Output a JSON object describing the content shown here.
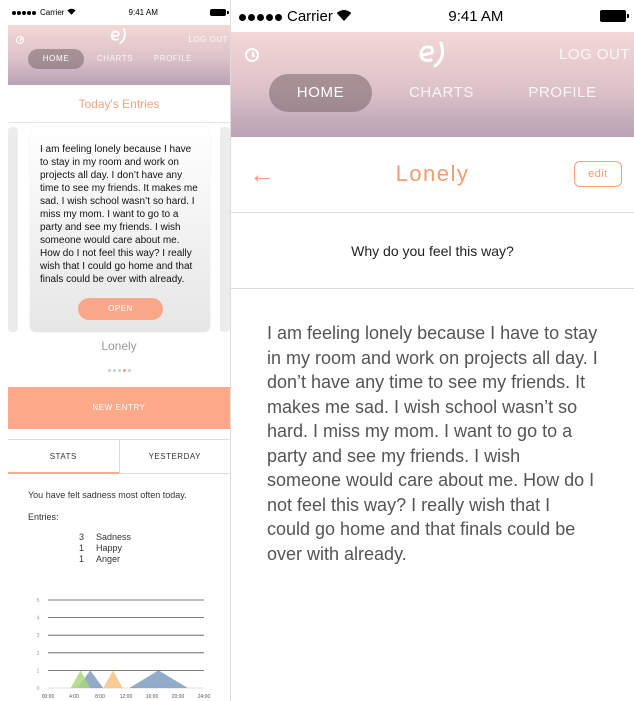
{
  "status": {
    "carrier": "Carrier",
    "time": "9:41 AM"
  },
  "header": {
    "logout_label": "LOG OUT",
    "tabs": [
      {
        "label": "HOME",
        "active": true
      },
      {
        "label": "CHARTS",
        "active": false
      },
      {
        "label": "PROFILE",
        "active": false
      }
    ]
  },
  "home": {
    "section_title": "Today's Entries",
    "card": {
      "text": "I am feeling lonely because I have to stay in my room and work on projects all day. I don’t have any time to see my friends. It makes me sad. I wish school wasn’t so hard. I miss my mom. I want to go to a party and see my friends. I wish someone would care about me. How do I not feel this way? I really wish that I could go home and that finals could be over with already.",
      "open_label": "OPEN",
      "caption": "Lonely"
    },
    "pager_count": 5,
    "pager_active": 4,
    "new_entry_label": "NEW ENTRY",
    "segments": [
      "STATS",
      "YESTERDAY"
    ],
    "stats_message": "You have felt sadness most often today.",
    "entries_label": "Entries:",
    "entries": [
      {
        "count": "3",
        "emotion": "Sadness"
      },
      {
        "count": "1",
        "emotion": "Happy"
      },
      {
        "count": "1",
        "emotion": "Anger"
      }
    ]
  },
  "detail": {
    "title": "Lonely",
    "edit_label": "edit",
    "question": "Why do you feel this way?",
    "body": "I am feeling lonely because I have to stay in my room and work on projects all day. I don’t have any time to see my friends. It makes me sad. I wish school wasn’t so hard. I miss my mom. I want to go to a party and see my friends. I wish someone would care about me. How do I not feel this way? I really wish that I could go home and that finals could be over with already."
  },
  "colors": {
    "accent": "#fea98a",
    "accent_text": "#f49b6f",
    "sadness": "#7f9cc0",
    "happy": "#a9d780",
    "anger": "#f6c283"
  },
  "chart_data": {
    "type": "area",
    "x_ticks": [
      "00:00",
      "4:00",
      "8:00",
      "12:00",
      "16:00",
      "20:00",
      "24:00"
    ],
    "y_ticks": [
      "0",
      "1",
      "2",
      "3",
      "4",
      "5"
    ],
    "ylim": [
      0,
      5
    ],
    "xlim": [
      0,
      24
    ],
    "grid": true,
    "series": [
      {
        "color": "#7f9cc0",
        "points": [
          [
            4.5,
            0
          ],
          [
            6.5,
            1
          ],
          [
            8.5,
            0
          ]
        ]
      },
      {
        "color": "#7f9cc0",
        "points": [
          [
            12.5,
            0
          ],
          [
            17,
            1
          ],
          [
            21.5,
            0
          ]
        ]
      },
      {
        "color": "#a9d780",
        "points": [
          [
            3.5,
            0
          ],
          [
            5,
            1
          ],
          [
            6.5,
            0
          ]
        ]
      },
      {
        "color": "#f6c283",
        "points": [
          [
            8.5,
            0
          ],
          [
            10,
            1
          ],
          [
            11.5,
            0
          ]
        ]
      }
    ]
  }
}
